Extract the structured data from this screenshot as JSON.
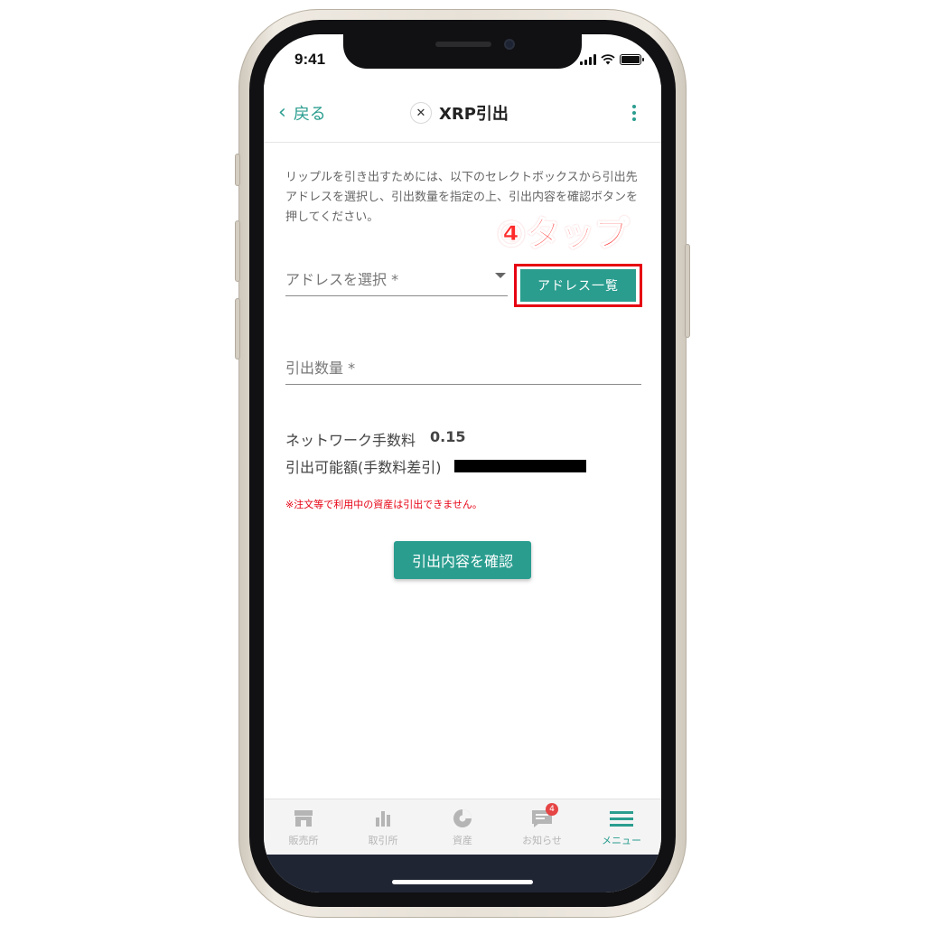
{
  "status_bar": {
    "time": "9:41"
  },
  "header": {
    "back_label": "戻る",
    "coin_icon": "xrp-icon",
    "title": "XRP引出",
    "menu_icon": "kebab-menu-icon"
  },
  "description": "リップルを引き出すためには、以下のセレクトボックスから引出先アドレスを選択し、引出数量を指定の上、引出内容を確認ボタンを押してください。",
  "address_select": {
    "placeholder": "アドレスを選択 *"
  },
  "address_list_button": {
    "label": "アドレス一覧"
  },
  "annotation": {
    "text": "④タップ",
    "color": "#e60012"
  },
  "amount_field": {
    "placeholder": "引出数量 *"
  },
  "fee": {
    "label": "ネットワーク手数料",
    "value": "0.15"
  },
  "available": {
    "label": "引出可能額(手数料差引)"
  },
  "notice": "※注文等で利用中の資産は引出できません。",
  "confirm_button": {
    "label": "引出内容を確認"
  },
  "bottom_nav": [
    {
      "label": "販売所",
      "icon": "store-icon"
    },
    {
      "label": "取引所",
      "icon": "bar-chart-icon"
    },
    {
      "label": "資産",
      "icon": "pie-chart-icon"
    },
    {
      "label": "お知らせ",
      "icon": "message-icon",
      "badge": "4"
    },
    {
      "label": "メニュー",
      "icon": "hamburger-menu-icon",
      "active": true
    }
  ],
  "colors": {
    "accent": "#2a9d8f",
    "alert": "#e60012"
  }
}
